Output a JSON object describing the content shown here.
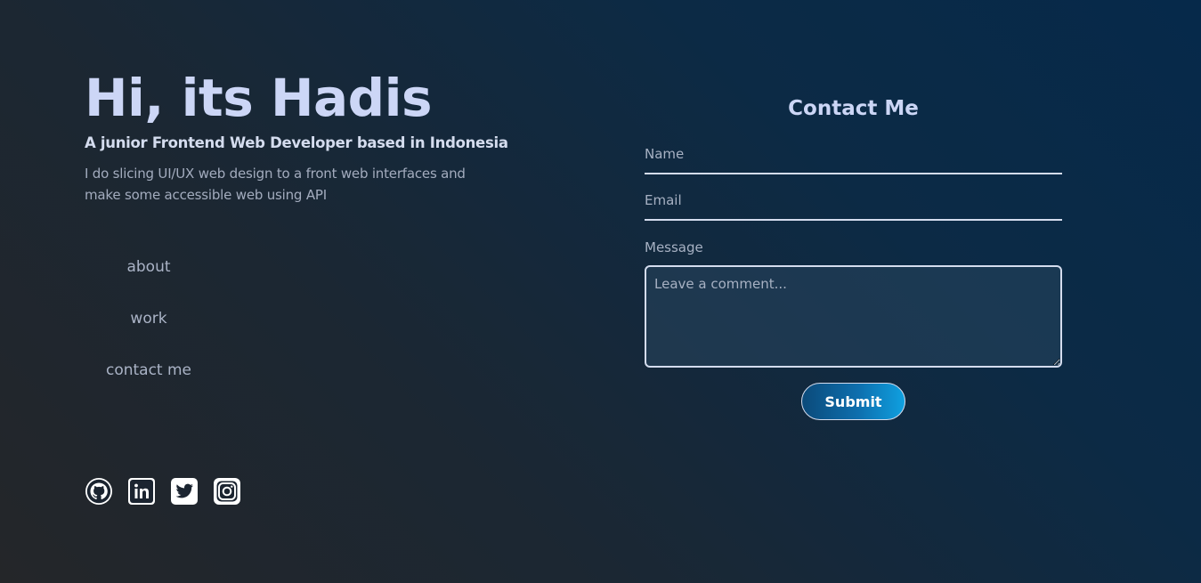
{
  "hero": {
    "title": "Hi, its Hadis",
    "subtitle": "A junior Frontend Web Developer based in Indonesia",
    "description": "I do slicing UI/UX web design to a front web interfaces and make some accessible web using API"
  },
  "nav": {
    "items": [
      {
        "label": "about"
      },
      {
        "label": "work"
      },
      {
        "label": "contact me"
      }
    ]
  },
  "socials": [
    "github-icon",
    "linkedin-icon",
    "twitter-icon",
    "instagram-icon"
  ],
  "contact": {
    "title": "Contact Me",
    "name_placeholder": "Name",
    "email_placeholder": "Email",
    "message_label": "Message",
    "message_placeholder": "Leave a comment...",
    "submit_label": "Submit"
  },
  "colors": {
    "text_primary": "#ccd6f6",
    "text_muted": "#a3acbe",
    "accent": "#0e6fae"
  }
}
